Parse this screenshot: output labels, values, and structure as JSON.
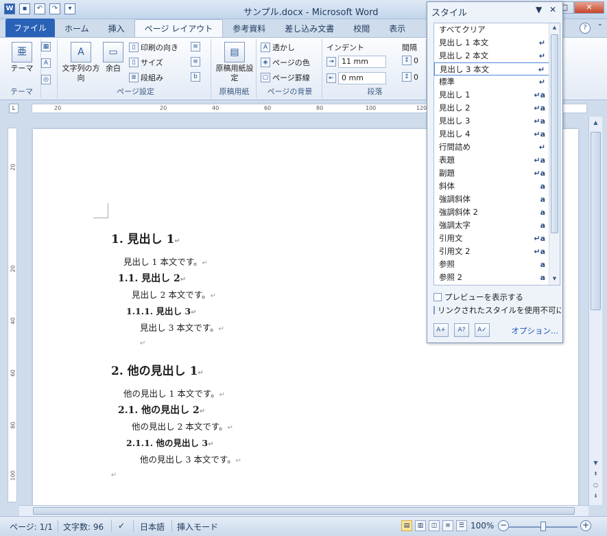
{
  "window": {
    "title": "サンプル.docx - Microsoft Word",
    "minimize": "–",
    "maximize": "□",
    "close": "✕"
  },
  "tabs": [
    {
      "label": "ファイル"
    },
    {
      "label": "ホーム"
    },
    {
      "label": "挿入"
    },
    {
      "label": "ページ レイアウト"
    },
    {
      "label": "参考資料"
    },
    {
      "label": "差し込み文書"
    },
    {
      "label": "校閲"
    },
    {
      "label": "表示"
    }
  ],
  "ribbon": {
    "theme": {
      "button": "テーマ",
      "group": "テーマ"
    },
    "page_setup": {
      "text_direction": "文字列の方向",
      "margins": "余白",
      "orientation": "印刷の向き",
      "size": "サイズ",
      "columns": "段組み",
      "group": "ページ設定"
    },
    "manuscript": {
      "button": "原稿用紙設定",
      "group": "原稿用紙"
    },
    "background": {
      "watermark": "透かし",
      "page_color": "ページの色",
      "page_borders": "ページ罫線",
      "group": "ページの背景"
    },
    "paragraph": {
      "indent": "インデント",
      "indent_left": "11 mm",
      "indent_right": "0 mm",
      "spacing": "間隔",
      "spacing_before": "0",
      "spacing_after": "0",
      "group": "段落"
    }
  },
  "ruler_ticks": [
    "20",
    "20",
    "40",
    "60",
    "80",
    "100",
    "120"
  ],
  "vruler_ticks": [
    "20",
    "20",
    "40",
    "60",
    "80",
    "100"
  ],
  "document": {
    "lines": [
      {
        "text": "1. 見出し 1",
        "style": "h1"
      },
      {
        "text": "見出し 1 本文です。",
        "style": "body"
      },
      {
        "text": "1.1. 見出し 2",
        "style": "h2"
      },
      {
        "text": "見出し 2 本文です。",
        "style": "body"
      },
      {
        "text": "1.1.1. 見出し 3",
        "style": "h3"
      },
      {
        "text": "見出し 3 本文です。",
        "style": "body"
      },
      {
        "text": "",
        "style": "body"
      },
      {
        "text": "2. 他の見出し 1",
        "style": "h1"
      },
      {
        "text": "他の見出し 1 本文です。",
        "style": "body"
      },
      {
        "text": "2.1. 他の見出し 2",
        "style": "h2"
      },
      {
        "text": "他の見出し 2 本文です。",
        "style": "body"
      },
      {
        "text": "2.1.1. 他の見出し 3",
        "style": "h3"
      },
      {
        "text": "他の見出し 3 本文です。",
        "style": "body"
      },
      {
        "text": "",
        "style": "body"
      }
    ],
    "paragraph_mark": "↵"
  },
  "status": {
    "page": "ページ: 1/1",
    "words": "文字数: 96",
    "language": "日本語",
    "mode": "挿入モード",
    "zoom": "100%"
  },
  "styles_pane": {
    "title": "スタイル",
    "items": [
      {
        "name": "すべてクリア",
        "glyph": ""
      },
      {
        "name": "見出し 1 本文",
        "glyph": "↵"
      },
      {
        "name": "見出し 2 本文",
        "glyph": "↵"
      },
      {
        "name": "見出し 3 本文",
        "glyph": "↵"
      },
      {
        "name": "標準",
        "glyph": "↵"
      },
      {
        "name": "見出し 1",
        "glyph": "↵a"
      },
      {
        "name": "見出し 2",
        "glyph": "↵a"
      },
      {
        "name": "見出し 3",
        "glyph": "↵a"
      },
      {
        "name": "見出し 4",
        "glyph": "↵a"
      },
      {
        "name": "行間詰め",
        "glyph": "↵"
      },
      {
        "name": "表題",
        "glyph": "↵a"
      },
      {
        "name": "副題",
        "glyph": "↵a"
      },
      {
        "name": "斜体",
        "glyph": "a"
      },
      {
        "name": "強調斜体",
        "glyph": "a"
      },
      {
        "name": "強調斜体 2",
        "glyph": "a"
      },
      {
        "name": "強調太字",
        "glyph": "a"
      },
      {
        "name": "引用文",
        "glyph": "↵a"
      },
      {
        "name": "引用文 2",
        "glyph": "↵a"
      },
      {
        "name": "参照",
        "glyph": "a"
      },
      {
        "name": "参照 2",
        "glyph": "a"
      }
    ],
    "selected_index": 3,
    "show_preview": "プレビューを表示する",
    "disable_linked": "リンクされたスタイルを使用不可にする",
    "options": "オプション..."
  }
}
